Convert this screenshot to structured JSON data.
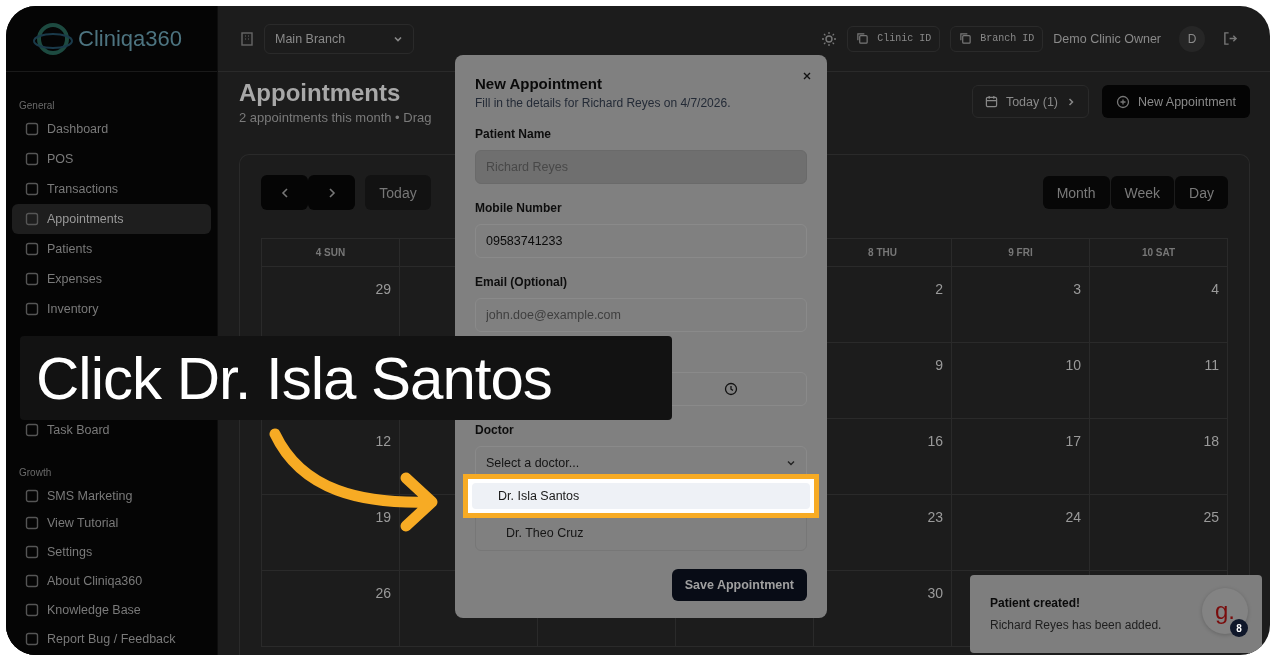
{
  "sidebar": {
    "logo_text": "Cliniqa360",
    "sections": [
      {
        "heading": "General",
        "items": [
          {
            "label": "Dashboard",
            "selected": false
          },
          {
            "label": "POS",
            "selected": false
          },
          {
            "label": "Transactions",
            "selected": false
          },
          {
            "label": "Appointments",
            "selected": true
          },
          {
            "label": "Patients",
            "selected": false
          },
          {
            "label": "Expenses",
            "selected": false
          },
          {
            "label": "Inventory",
            "selected": false
          }
        ]
      },
      {
        "items": [
          {
            "label": "Task Board",
            "selected": false
          }
        ]
      },
      {
        "heading": "Growth",
        "items": [
          {
            "label": "SMS Marketing",
            "selected": false
          }
        ]
      }
    ],
    "footer_items": [
      "View Tutorial",
      "Settings",
      "About Cliniqa360",
      "Knowledge Base",
      "Report Bug / Feedback"
    ]
  },
  "topbar": {
    "branch_select": "Main Branch",
    "clinic_id_button": "Clinic ID",
    "branch_id_button": "Branch ID",
    "user_name": "Demo Clinic Owner",
    "avatar_initial": "D"
  },
  "page": {
    "title": "Appointments",
    "subtitle": "2 appointments this month • Drag",
    "today_button": "Today (1)",
    "new_button": "New Appointment"
  },
  "calendar": {
    "today_button": "Today",
    "views": [
      "Month",
      "Week",
      "Day"
    ],
    "headers": {
      "sun": "4 SUN",
      "thu": "8 THU",
      "fri": "9 FRI",
      "sat": "10 SAT"
    },
    "weeks": [
      {
        "sun": "29",
        "thu": "2",
        "fri": "3",
        "sat": "4"
      },
      {
        "thu": "9",
        "fri": "10",
        "sat": "11"
      },
      {
        "sun": "12",
        "thu": "16",
        "fri": "17",
        "sat": "18"
      },
      {
        "sun": "19",
        "thu": "23",
        "fri": "24",
        "sat": "25"
      },
      {
        "sun": "26",
        "thu": "30"
      }
    ]
  },
  "dialog": {
    "title": "New Appointment",
    "subtitle": "Fill in the details for Richard Reyes on 4/7/2026.",
    "fields": [
      {
        "label": "Patient Name",
        "value": "Richard Reyes",
        "disabled": true
      },
      {
        "label": "Mobile Number",
        "value": "09583741233",
        "disabled": false
      },
      {
        "label": "Email (Optional)",
        "placeholder": "john.doe@example.com",
        "disabled": false
      }
    ],
    "doctor": {
      "label": "Doctor",
      "placeholder": "Select a doctor...",
      "options": [
        {
          "label": "Dr. Isla Santos",
          "selected": true
        },
        {
          "label": "Dr. Theo Cruz",
          "selected": false
        }
      ]
    },
    "save_button": "Save Appointment"
  },
  "tutorial": {
    "caption": "Click Dr. Isla Santos"
  },
  "toast": {
    "title": "Patient created!",
    "message": "Richard Reyes has been added.",
    "widget_logo": "g.",
    "widget_badge": "8"
  }
}
